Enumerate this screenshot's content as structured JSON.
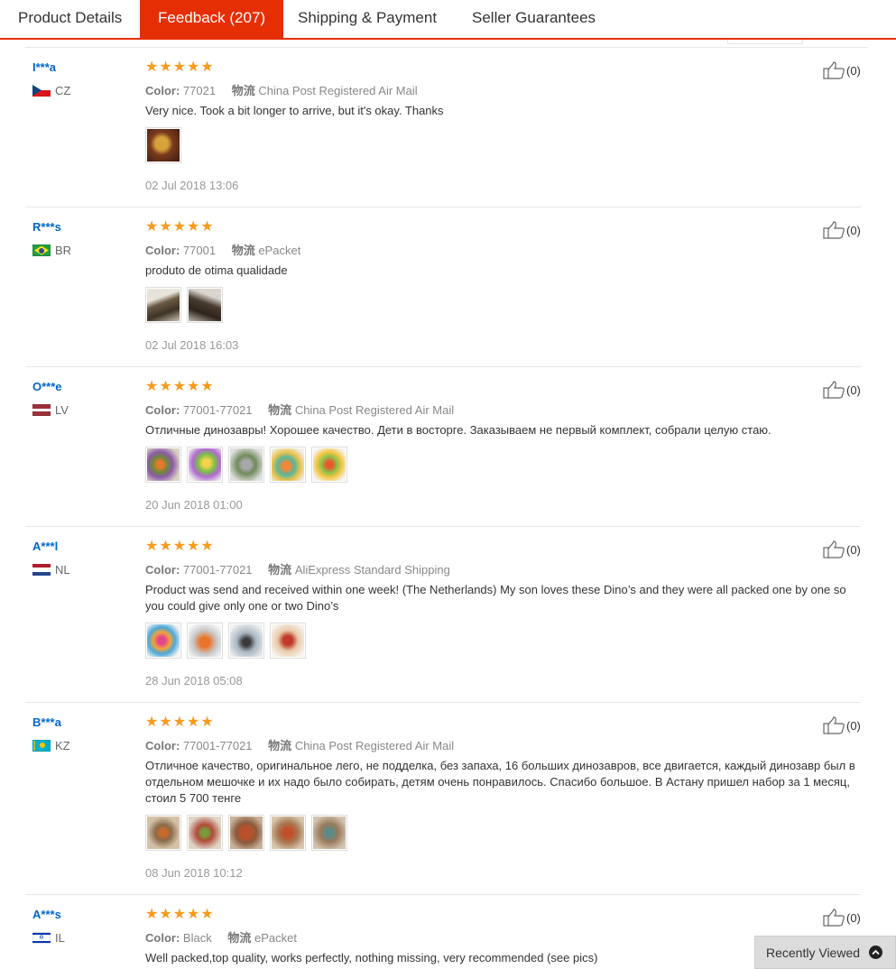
{
  "tabs": [
    "Product Details",
    "Feedback (207)",
    "Shipping & Payment",
    "Seller Guarantees"
  ],
  "labels": {
    "color": "Color:",
    "shipping": "物流"
  },
  "rating_stars": "★★★★★",
  "colors": {
    "accent": "#e62e04",
    "star": "#f89a1c",
    "link": "#0066cc"
  },
  "reviews": [
    {
      "user": "I***a",
      "country": "CZ",
      "flag": "cz",
      "color": "77021",
      "shipping": "China Post Registered Air Mail",
      "text": "Very nice. Took a bit longer to arrive, but it's okay. Thanks",
      "likes": "(0)",
      "date": "02 Jul 2018 13:06",
      "images": 1
    },
    {
      "user": "R***s",
      "country": "BR",
      "flag": "br",
      "color": "77001",
      "shipping": "ePacket",
      "text": "produto de otima qualidade",
      "likes": "(0)",
      "date": "02 Jul 2018 16:03",
      "images": 2
    },
    {
      "user": "O***e",
      "country": "LV",
      "flag": "lv",
      "color": "77001-77021",
      "shipping": "China Post Registered Air Mail",
      "text": "Отличные динозавры! Хорошее качество. Дети в восторге. Заказываем не первый комплект, собрали целую стаю.",
      "likes": "(0)",
      "date": "20 Jun 2018 01:00",
      "images": 5
    },
    {
      "user": "A***l",
      "country": "NL",
      "flag": "nl",
      "color": "77001-77021",
      "shipping": "AliExpress Standard Shipping",
      "text": "Product was send and received within one week! (The Netherlands) My son loves these Dino’s and they were all packed one by one so you could give only one or two Dino’s",
      "likes": "(0)",
      "date": "28 Jun 2018 05:08",
      "images": 4
    },
    {
      "user": "B***a",
      "country": "KZ",
      "flag": "kz",
      "color": "77001-77021",
      "shipping": "China Post Registered Air Mail",
      "text": "Отличное качество, оригинальное лего, не подделка, без запаха, 16 больших динозавров, все двигается, каждый динозавр был в отдельном мешочке и их надо было собирать, детям очень понравилось. Спасибо большое. В Астану пришел набор за 1 месяц, стоил 5 700 тенге",
      "likes": "(0)",
      "date": "08 Jun 2018 10:12",
      "images": 5
    },
    {
      "user": "A***s",
      "country": "IL",
      "flag": "il",
      "color": "Black",
      "shipping": "ePacket",
      "text": "Well packed,top quality, works perfectly, nothing missing, very recommended (see pics)",
      "likes": "(0)",
      "date": "",
      "images": 0
    }
  ],
  "recently_viewed": "Recently Viewed"
}
